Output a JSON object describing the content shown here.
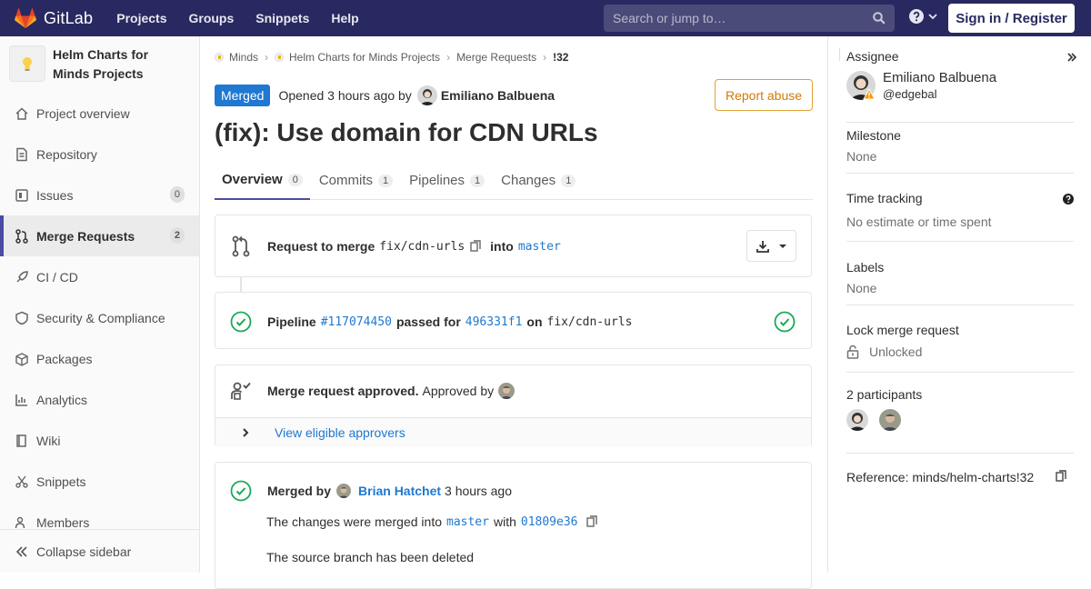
{
  "topbar": {
    "brand": "GitLab",
    "nav": [
      "Projects",
      "Groups",
      "Snippets",
      "Help"
    ],
    "search_placeholder": "Search or jump to…",
    "signin_label": "Sign in / Register",
    "colors": {
      "bar": "#292961",
      "accent": "#4b4ba3"
    }
  },
  "sidebar": {
    "project_name": "Helm Charts for Minds Projects",
    "items": [
      {
        "label": "Project overview",
        "icon": "home-icon"
      },
      {
        "label": "Repository",
        "icon": "doc-icon"
      },
      {
        "label": "Issues",
        "icon": "issues-icon",
        "count": "0"
      },
      {
        "label": "Merge Requests",
        "icon": "merge-request-icon",
        "count": "2",
        "active": true
      },
      {
        "label": "CI / CD",
        "icon": "rocket-icon"
      },
      {
        "label": "Security & Compliance",
        "icon": "shield-icon"
      },
      {
        "label": "Packages",
        "icon": "package-icon"
      },
      {
        "label": "Analytics",
        "icon": "chart-icon"
      },
      {
        "label": "Wiki",
        "icon": "book-icon"
      },
      {
        "label": "Snippets",
        "icon": "scissors-icon"
      },
      {
        "label": "Members",
        "icon": "users-icon"
      }
    ],
    "collapse_label": "Collapse sidebar"
  },
  "breadcrumb": [
    "Minds",
    "Helm Charts for Minds Projects",
    "Merge Requests",
    "!32"
  ],
  "mr": {
    "status": "Merged",
    "opened_text": "Opened 3 hours ago by",
    "author": "Emiliano Balbuena",
    "report_label": "Report abuse",
    "title": "(fix): Use domain for CDN URLs",
    "tabs": [
      {
        "label": "Overview",
        "count": "0",
        "active": true
      },
      {
        "label": "Commits",
        "count": "1"
      },
      {
        "label": "Pipelines",
        "count": "1"
      },
      {
        "label": "Changes",
        "count": "1"
      }
    ]
  },
  "request": {
    "prefix": "Request to merge",
    "source": "fix/cdn-urls",
    "into": "into",
    "target": "master"
  },
  "pipeline": {
    "label": "Pipeline",
    "id": "#117074450",
    "passed": "passed for",
    "sha": "496331f1",
    "on": "on",
    "branch": "fix/cdn-urls"
  },
  "approval": {
    "text": "Merge request approved.",
    "approved_by": "Approved by",
    "view_label": "View eligible approvers"
  },
  "merged": {
    "label": "Merged by",
    "user": "Brian Hatchet",
    "time": "3 hours ago",
    "line1_prefix": "The changes were merged into",
    "line1_branch": "master",
    "line1_with": "with",
    "line1_sha": "01809e36",
    "line2": "The source branch has been deleted"
  },
  "right_sidebar": {
    "assignee_title": "Assignee",
    "assignee_name": "Emiliano Balbuena",
    "assignee_handle": "@edgebal",
    "milestone_title": "Milestone",
    "milestone_value": "None",
    "time_title": "Time tracking",
    "time_value": "No estimate or time spent",
    "labels_title": "Labels",
    "labels_value": "None",
    "lock_title": "Lock merge request",
    "lock_value": "Unlocked",
    "participants_title": "2 participants",
    "reference": "Reference: minds/helm-charts!32"
  }
}
